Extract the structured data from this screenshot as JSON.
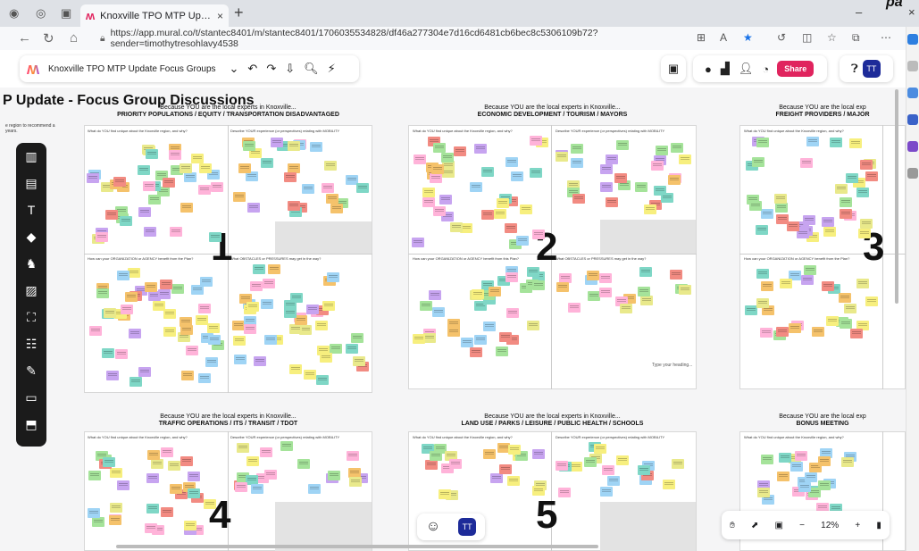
{
  "browser": {
    "tab_title": "Knoxville TPO MTP Update Focu...",
    "tab_close": "×",
    "new_tab": "+",
    "url": "https://app.mural.co/t/stantec8401/m/stantec8401/1706035534828/df46a277304e7d16cd6481cb6bec8c5306109b72?sender=timothytresohlavy4538",
    "window_min": "–",
    "window_close": "×",
    "corner_text": "pa"
  },
  "mural": {
    "name": "Knoxville TPO MTP Update Focus Groups",
    "share_label": "Share",
    "user_initials": "TT",
    "board_title": "P Update - Focus Group Discussions",
    "left_note": "e region to recommend a years.",
    "zoom_level": "12%",
    "zoom_minus": "−",
    "zoom_plus": "+"
  },
  "panels": [
    {
      "number": "1",
      "head1": "Because YOU are the local experts in Knoxville...",
      "head2": "PRIORITY POPULATIONS / EQUITY / TRANSPORTATION DISADVANTAGED",
      "q1": "What do YOU find unique about the Knoxville region, and why?",
      "q2": "Describe YOUR experience (or perspectives) relating with MOBILITY",
      "q3": "How can your ORGANIZATION or AGENCY benefit from the Plan?",
      "q4": "What OBSTACLES or PRESSURES may get in the way?"
    },
    {
      "number": "2",
      "head1": "Because YOU are the local experts in Knoxville...",
      "head2": "ECONOMIC DEVELOPMENT / TOURISM / MAYORS",
      "q1": "What do YOU find unique about the Knoxville region, and why?",
      "q2": "Describe YOUR experience (or perspectives) relating with MOBILITY",
      "q3": "How can your ORGANIZATION or AGENCY benefit from this Plan?",
      "q4": "What OBSTACLES or PRESSURES may get in the way?",
      "placeholder": "Type your heading..."
    },
    {
      "number": "3",
      "head1": "Because YOU are the local exp",
      "head2": "FREIGHT PROVIDERS / MAJOR",
      "q1": "What do YOU find unique about the Knoxville region, and why?",
      "q3": "How can your ORGANIZATION or AGENCY benefit from the Plan?"
    },
    {
      "number": "4",
      "head1": "Because YOU are the local experts in Knoxville...",
      "head2": "TRAFFIC OPERATIONS / ITS / TRANSIT / TDOT",
      "q1": "What do YOU find unique about the Knoxville region, and why?",
      "q2": "Describe YOUR experience (or perspectives) relating with MOBILITY"
    },
    {
      "number": "5",
      "head1": "Because YOU are the local experts in Knoxville...",
      "head2": "LAND USE / PARKS / LEISURE / PUBLIC HEALTH / SCHOOLS",
      "q1": "What do YOU find unique about the Knoxville region, and why?",
      "q2": "Describe YOUR experience (or perspectives) relating with MOBILITY"
    },
    {
      "number": "",
      "head1": "Because YOU are the local exp",
      "head2": "BONUS MEETING",
      "q1": "What do YOU find unique about the Knoxville region, and why?"
    }
  ],
  "note_colors": [
    "#f7ef7e",
    "#a5e39a",
    "#ffb3d9",
    "#9fd4f5",
    "#f5c26b",
    "#c7a4f0",
    "#f28b82",
    "#7fd7c6",
    "#e9e98b"
  ]
}
